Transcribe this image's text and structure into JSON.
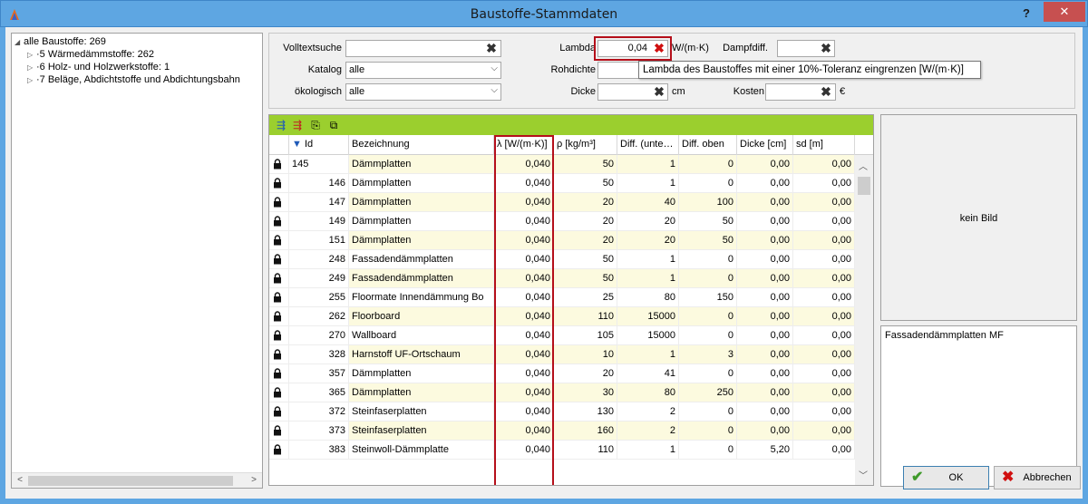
{
  "window": {
    "title": "Baustoffe-Stammdaten",
    "help_label": "?",
    "close_label": "✕"
  },
  "tree": {
    "items": [
      {
        "toggle": "◢",
        "label": "alle Baustoffe: 269"
      },
      {
        "toggle": "▷",
        "label": "5 Wärmedämmstoffe: 262"
      },
      {
        "toggle": "▷",
        "label": "6 Holz- und Holzwerkstoffe: 1"
      },
      {
        "toggle": "▷",
        "label": "7 Beläge, Abdichtstoffe und Abdichtungsbahn"
      }
    ]
  },
  "filters": {
    "volltext_label": "Volltextsuche",
    "volltext_value": "",
    "katalog_label": "Katalog",
    "katalog_value": "alle",
    "oekologisch_label": "ökologisch",
    "oekologisch_value": "alle",
    "lambda_label": "Lambda",
    "lambda_value": "0,04",
    "lambda_unit": "W/(m·K)",
    "dampfdiff_label": "Dampfdiff.",
    "dampfdiff_value": "",
    "rohdichte_label": "Rohdichte",
    "rohdichte_value": "",
    "dicke_label": "Dicke",
    "dicke_value": "",
    "dicke_unit": "cm",
    "kosten_label": "Kosten",
    "kosten_value": "",
    "kosten_unit": "€",
    "tooltip": "Lambda des Baustoffes mit einer 10%-Toleranz eingrenzen [W/(m·K)]"
  },
  "grid": {
    "toolbar_icons": [
      "add-row-icon",
      "remove-row-icon",
      "copy-icon",
      "export-icon"
    ],
    "sort_indicator": "▼",
    "columns": [
      "Id",
      "Bezeichnung",
      "λ [W/(m·K)]",
      "ρ [kg/m³]",
      "Diff. (unte…",
      "Diff. oben",
      "Dicke [cm]",
      "sd [m]"
    ],
    "rows": [
      {
        "id": "145",
        "bez": "Dämmplatten",
        "lambda": "0,040",
        "rho": "50",
        "du": "1",
        "do": "0",
        "dicke": "0,00",
        "sd": "0,00"
      },
      {
        "id": "146",
        "bez": "Dämmplatten",
        "lambda": "0,040",
        "rho": "50",
        "du": "1",
        "do": "0",
        "dicke": "0,00",
        "sd": "0,00"
      },
      {
        "id": "147",
        "bez": "Dämmplatten",
        "lambda": "0,040",
        "rho": "20",
        "du": "40",
        "do": "100",
        "dicke": "0,00",
        "sd": "0,00"
      },
      {
        "id": "149",
        "bez": "Dämmplatten",
        "lambda": "0,040",
        "rho": "20",
        "du": "20",
        "do": "50",
        "dicke": "0,00",
        "sd": "0,00"
      },
      {
        "id": "151",
        "bez": "Dämmplatten",
        "lambda": "0,040",
        "rho": "20",
        "du": "20",
        "do": "50",
        "dicke": "0,00",
        "sd": "0,00"
      },
      {
        "id": "248",
        "bez": "Fassadendämmplatten",
        "lambda": "0,040",
        "rho": "50",
        "du": "1",
        "do": "0",
        "dicke": "0,00",
        "sd": "0,00"
      },
      {
        "id": "249",
        "bez": "Fassadendämmplatten",
        "lambda": "0,040",
        "rho": "50",
        "du": "1",
        "do": "0",
        "dicke": "0,00",
        "sd": "0,00"
      },
      {
        "id": "255",
        "bez": "Floormate Innendämmung Bo",
        "lambda": "0,040",
        "rho": "25",
        "du": "80",
        "do": "150",
        "dicke": "0,00",
        "sd": "0,00"
      },
      {
        "id": "262",
        "bez": "Floorboard",
        "lambda": "0,040",
        "rho": "110",
        "du": "15000",
        "do": "0",
        "dicke": "0,00",
        "sd": "0,00"
      },
      {
        "id": "270",
        "bez": "Wallboard",
        "lambda": "0,040",
        "rho": "105",
        "du": "15000",
        "do": "0",
        "dicke": "0,00",
        "sd": "0,00"
      },
      {
        "id": "328",
        "bez": "Harnstoff UF-Ortschaum",
        "lambda": "0,040",
        "rho": "10",
        "du": "1",
        "do": "3",
        "dicke": "0,00",
        "sd": "0,00"
      },
      {
        "id": "357",
        "bez": "Dämmplatten",
        "lambda": "0,040",
        "rho": "20",
        "du": "41",
        "do": "0",
        "dicke": "0,00",
        "sd": "0,00"
      },
      {
        "id": "365",
        "bez": "Dämmplatten",
        "lambda": "0,040",
        "rho": "30",
        "du": "80",
        "do": "250",
        "dicke": "0,00",
        "sd": "0,00"
      },
      {
        "id": "372",
        "bez": "Steinfaserplatten",
        "lambda": "0,040",
        "rho": "130",
        "du": "2",
        "do": "0",
        "dicke": "0,00",
        "sd": "0,00"
      },
      {
        "id": "373",
        "bez": "Steinfaserplatten",
        "lambda": "0,040",
        "rho": "160",
        "du": "2",
        "do": "0",
        "dicke": "0,00",
        "sd": "0,00"
      },
      {
        "id": "383",
        "bez": "Steinwoll-Dämmplatte",
        "lambda": "0,040",
        "rho": "110",
        "du": "1",
        "do": "0",
        "dicke": "5,20",
        "sd": "0,00"
      }
    ]
  },
  "image_panel": {
    "text": "kein Bild"
  },
  "description": {
    "text": "Fassadendämmplatten MF"
  },
  "buttons": {
    "ok": "OK",
    "cancel": "Abbrechen"
  },
  "colors": {
    "title_bar": "#5ea6e2",
    "toolbar": "#9bcf2e",
    "row_highlight": "#fcfadf",
    "highlight_border": "#b50f1a"
  }
}
